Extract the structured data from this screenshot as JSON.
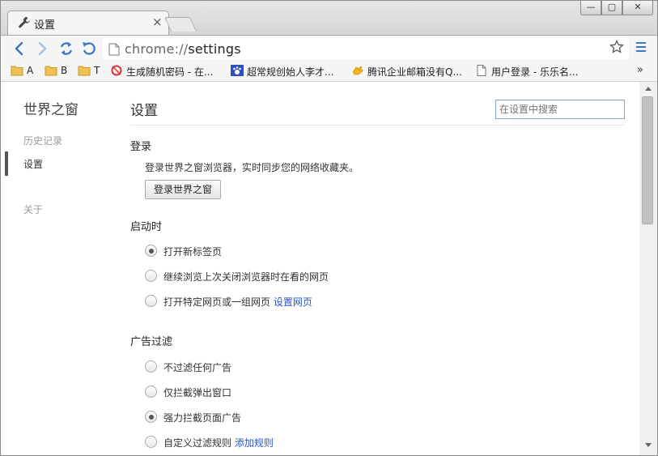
{
  "tab": {
    "title": "设置",
    "close": "×"
  },
  "window": {
    "minimize": "—",
    "maximize": "▢",
    "close": "✕"
  },
  "toolbar": {
    "url_scheme": "chrome://",
    "url_path": "settings"
  },
  "bookmarks": [
    {
      "label": "A",
      "icon": "folder-icon"
    },
    {
      "label": "B",
      "icon": "folder-icon"
    },
    {
      "label": "T",
      "icon": "folder-icon"
    },
    {
      "label": "生成随机密码 - 在...",
      "icon": "site-icon"
    },
    {
      "label": "超常规创始人李才...",
      "icon": "baidu-paw-icon"
    },
    {
      "label": "腾讯企业邮箱没有Q...",
      "icon": "hand-icon"
    },
    {
      "label": "用户登录 - 乐乐名...",
      "icon": "page-icon"
    }
  ],
  "bookmarks_more": "»",
  "sidebar": {
    "brand": "世界之窗",
    "items": [
      {
        "label": "历史记录"
      },
      {
        "label": "设置"
      },
      {
        "label": "关于"
      }
    ]
  },
  "main": {
    "title": "设置",
    "search_placeholder": "在设置中搜索",
    "login": {
      "heading": "登录",
      "description": "登录世界之窗浏览器，实时同步您的网络收藏夹。",
      "button": "登录世界之窗"
    },
    "startup": {
      "heading": "启动时",
      "options": [
        {
          "label": "打开新标签页",
          "selected": true
        },
        {
          "label": "继续浏览上次关闭浏览器时在看的网页",
          "selected": false
        },
        {
          "label": "打开特定网页或一组网页",
          "link": "设置网页",
          "selected": false
        }
      ]
    },
    "adblock": {
      "heading": "广告过滤",
      "options": [
        {
          "label": "不过滤任何广告",
          "selected": false
        },
        {
          "label": "仅拦截弹出窗口",
          "selected": false
        },
        {
          "label": "强力拦截页面广告",
          "selected": true
        },
        {
          "label": "自定义过滤规则",
          "link": "添加规则",
          "selected": false
        }
      ]
    }
  }
}
